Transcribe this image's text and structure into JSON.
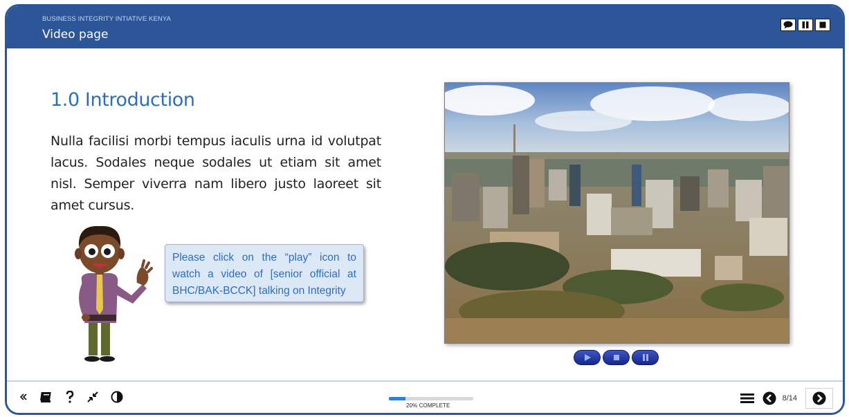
{
  "header": {
    "org": "BUSINESS INTEGRITY INTIATIVE KENYA",
    "page_title": "Video page",
    "controls": [
      "speech-bubble-icon",
      "pause-icon",
      "stop-icon"
    ]
  },
  "content": {
    "heading": "1.0 Introduction",
    "paragraph": "Nulla facilisi morbi tempus iaculis urna id volutpat lacus. Sodales neque sodales ut etiam sit amet nisl. Semper viverra nam libero justo laoreet sit amet cursus.",
    "callout": "Please click on the “play” icon to watch a video of [senior official at BHC/BAK-BCCK] talking on Integrity"
  },
  "video": {
    "controls": [
      "play-icon",
      "stop-icon",
      "pause-icon"
    ]
  },
  "footer": {
    "tools": [
      "collapse-icon",
      "glossary-book-icon",
      "help-icon",
      "minimize-icon",
      "contrast-icon"
    ],
    "progress_percent": 20,
    "progress_label": "20% COMPLETE",
    "page_indicator": "8/14",
    "nav": [
      "menu-icon",
      "previous-icon",
      "next-icon"
    ]
  },
  "colors": {
    "brand": "#2c5698",
    "accent": "#2c6fb8",
    "progress": "#2f7fd6"
  }
}
